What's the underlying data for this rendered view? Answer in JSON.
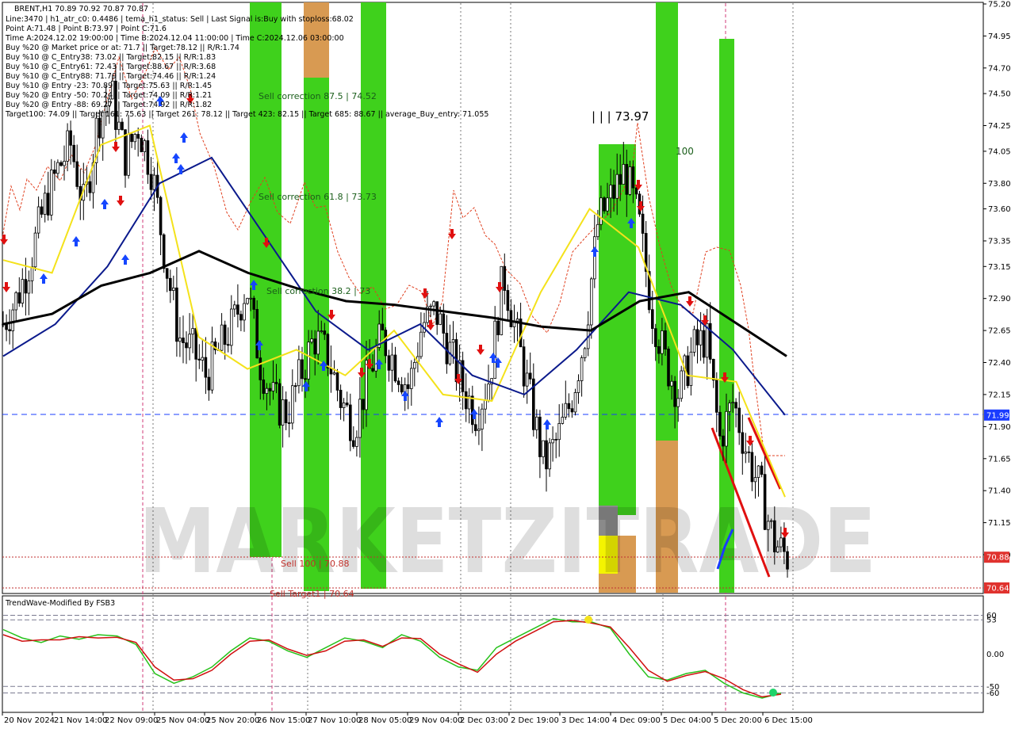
{
  "header": {
    "symbol_line": "BRENT,H1  70.89 70.92 70.87 70.87",
    "info_lines": [
      "Line:3470 | h1_atr_c0: 0.4486 | tema_h1_status: Sell | Last Signal is:Buy with stoploss:68.02",
      "Point A:71.48 | Point B:73.97 | Point C:71.6",
      "Time A:2024.12.02 19:00:00 | Time B:2024.12.04 11:00:00 | Time C:2024.12.06 03:00:00",
      "Buy %20 @ Market price or at: 71.7 || Target:78.12 || R/R:1.74",
      "Buy %10 @ C_Entry38: 73.02 || Target:82.15 || R/R:1.83",
      "Buy %10 @ C_Entry61: 72.43 || Target:88.67 || R/R:3.68",
      "Buy %10 @ C_Entry88: 71.79 || Target:74.46 || R/R:1.24",
      "Buy %10 @ Entry -23: 70.89 || Target:75.63 || R/R:1.45",
      "Buy %20 @ Entry -50: 70.24 || Target:74.09 || R/R:1.21",
      "Buy %20 @ Entry -88: 69.27 || Target:74.92 || R/R:1.82",
      "Target100: 74.09 || Target 161: 75.63 || Target 261: 78.12 || Target 423: 82.15 || Target 685: 88.67 || average_Buy_entry: 71.055"
    ]
  },
  "annotations": {
    "sell_corr_875": "Sell correction 87.5 | 74.52",
    "sell_corr_618": "Sell correction 61.8 | 73.73",
    "sell_corr_382": "Sell correction 38.2 | 73",
    "sell_100": "Sell 100 | 70.88",
    "sell_target": "Sell Target1 | 70.64",
    "peak_label": "| | | 73.97",
    "level_100": "100"
  },
  "watermark": "MARKETZITRADE",
  "price_axis": {
    "ticks": [
      "75.20",
      "74.95",
      "74.70",
      "74.50",
      "74.25",
      "74.05",
      "73.80",
      "73.60",
      "73.35",
      "73.15",
      "72.90",
      "72.65",
      "72.40",
      "72.15",
      "71.90",
      "71.65",
      "71.40",
      "71.15",
      "70.90"
    ],
    "tags": [
      {
        "label": "71.99",
        "value": 71.99,
        "color": "#1a3cff"
      },
      {
        "label": "70.88",
        "value": 70.88,
        "color": "#e0322e"
      },
      {
        "label": "70.64",
        "value": 70.64,
        "color": "#e0322e"
      }
    ]
  },
  "time_axis": {
    "labels": [
      "20 Nov 2024",
      "21 Nov 14:00",
      "22 Nov 09:00",
      "25 Nov 04:00",
      "25 Nov 20:00",
      "26 Nov 15:00",
      "27 Nov 10:00",
      "28 Nov 05:00",
      "29 Nov 04:00",
      "2 Dec 03:00",
      "2 Dec 19:00",
      "3 Dec 14:00",
      "4 Dec 09:00",
      "5 Dec 04:00",
      "5 Dec 20:00",
      "6 Dec 15:00"
    ]
  },
  "indicator": {
    "title": "TrendWave-Modified By FSB3",
    "ticks": [
      "60",
      "53",
      "0.00",
      "-50",
      "-60"
    ],
    "levels": [
      60,
      53,
      0,
      -50,
      -60
    ],
    "range": [
      -90,
      90
    ]
  },
  "colors": {
    "bull_candle": "#000000",
    "bear_candle": "#000000",
    "ma_black": "#000000",
    "ma_navy": "#0b1a8c",
    "ma_yellow": "#f4e21b",
    "zone_green": "#3fd11c",
    "zone_orange": "#d89a52",
    "buy_arrow": "#1646ff",
    "sell_arrow": "#e01010",
    "osc_green": "#27c21b",
    "osc_red": "#d01010",
    "dashed_red": "#e04020",
    "blue_level": "#1a3cff"
  },
  "chart_data": {
    "type": "candlestick",
    "title": "BRENT,H1",
    "ylim": [
      70.56,
      75.2
    ],
    "y_ticks": [
      75.2,
      74.95,
      74.7,
      74.5,
      74.25,
      74.05,
      73.8,
      73.6,
      73.35,
      73.15,
      72.9,
      72.65,
      72.4,
      72.15,
      71.9,
      71.65,
      71.4,
      71.15,
      70.9
    ],
    "levels": {
      "blue_dashed": 71.99,
      "sell_100": 70.88,
      "sell_target1": 70.64
    },
    "close_path": [
      72.7,
      72.9,
      73.2,
      73.6,
      73.9,
      74.1,
      73.6,
      74.3,
      74.5,
      74.0,
      74.25,
      73.9,
      73.2,
      72.6,
      72.5,
      72.3,
      72.5,
      72.7,
      73.0,
      72.4,
      72.1,
      72.0,
      72.3,
      72.6,
      72.45,
      72.1,
      71.9,
      72.3,
      72.6,
      72.4,
      72.2,
      72.7,
      72.8,
      72.5,
      72.2,
      72.0,
      72.3,
      73.1,
      72.6,
      72.1,
      71.6,
      71.8,
      72.1,
      72.6,
      73.5,
      73.7,
      73.9,
      73.5,
      72.8,
      72.4,
      72.15,
      72.5,
      72.6,
      71.8,
      72.1,
      71.7,
      71.4,
      71.0,
      70.88
    ],
    "ma_black": [
      72.7,
      72.78,
      73.0,
      73.1,
      73.27,
      73.1,
      72.98,
      72.88,
      72.85,
      72.8,
      72.75,
      72.68,
      72.65,
      72.88,
      72.95,
      72.7,
      72.45
    ],
    "ma_navy": [
      72.45,
      72.7,
      73.15,
      73.8,
      74.0,
      73.4,
      72.8,
      72.5,
      72.7,
      72.3,
      72.15,
      72.5,
      72.95,
      72.85,
      72.5,
      71.99
    ],
    "ma_yellow": [
      73.2,
      73.1,
      74.1,
      74.25,
      72.6,
      72.35,
      72.5,
      72.3,
      72.65,
      72.15,
      72.1,
      72.95,
      73.6,
      73.3,
      72.3,
      72.25,
      71.35
    ],
    "indicator_series": [
      {
        "name": "green",
        "values": [
          38,
          25,
          18,
          28,
          23,
          30,
          28,
          15,
          -30,
          -45,
          -35,
          -20,
          5,
          25,
          20,
          5,
          -5,
          10,
          25,
          20,
          10,
          30,
          20,
          -5,
          -20,
          -25,
          10,
          25,
          40,
          55,
          50,
          50,
          40,
          0,
          -35,
          -40,
          -30,
          -25,
          -45,
          -60,
          -68,
          -60
        ]
      },
      {
        "name": "red",
        "values": [
          30,
          20,
          22,
          22,
          27,
          25,
          26,
          18,
          -20,
          -40,
          -38,
          -25,
          0,
          20,
          22,
          8,
          -2,
          5,
          20,
          22,
          12,
          25,
          24,
          0,
          -15,
          -28,
          0,
          20,
          35,
          50,
          52,
          48,
          42,
          10,
          -25,
          -42,
          -33,
          -27,
          -38,
          -55,
          -66,
          -62
        ]
      }
    ]
  }
}
